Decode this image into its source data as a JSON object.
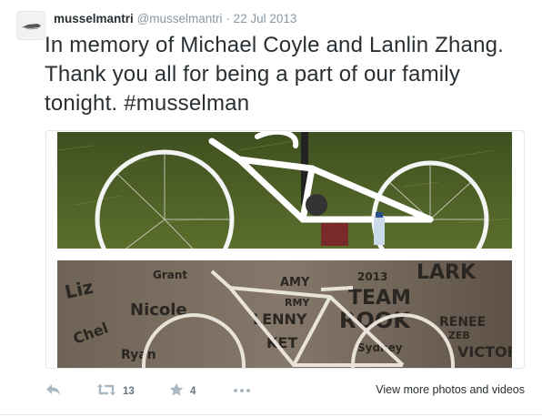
{
  "tweet": {
    "fullname": "musselmantri",
    "username": "@musselmantri",
    "separator": "·",
    "date": "22 Jul 2013",
    "text": "In memory of Michael Coyle and Lanlin Zhang. Thank you all for being a part of our family tonight. #musselman"
  },
  "photos": {
    "graffiti_words": [
      "Liz",
      "Grant",
      "Nicole",
      "Chel",
      "Ryan",
      "AMY",
      "2013",
      "LARK",
      "TEAM",
      "ROOK",
      "RENEE",
      "ZEB",
      "VICTOR",
      "LENNY",
      "KET",
      "Sydney",
      "RMY"
    ]
  },
  "actions": {
    "reply_icon": "reply-icon",
    "retweet_icon": "retweet-icon",
    "retweet_count": "13",
    "favorite_icon": "star-icon",
    "favorite_count": "4",
    "more_icon": "more-icon",
    "view_more_label": "View more photos and videos"
  },
  "colors": {
    "text": "#292f33",
    "muted": "#8899a6",
    "action_icon": "#aab8c2",
    "border": "#e1e8ed"
  }
}
